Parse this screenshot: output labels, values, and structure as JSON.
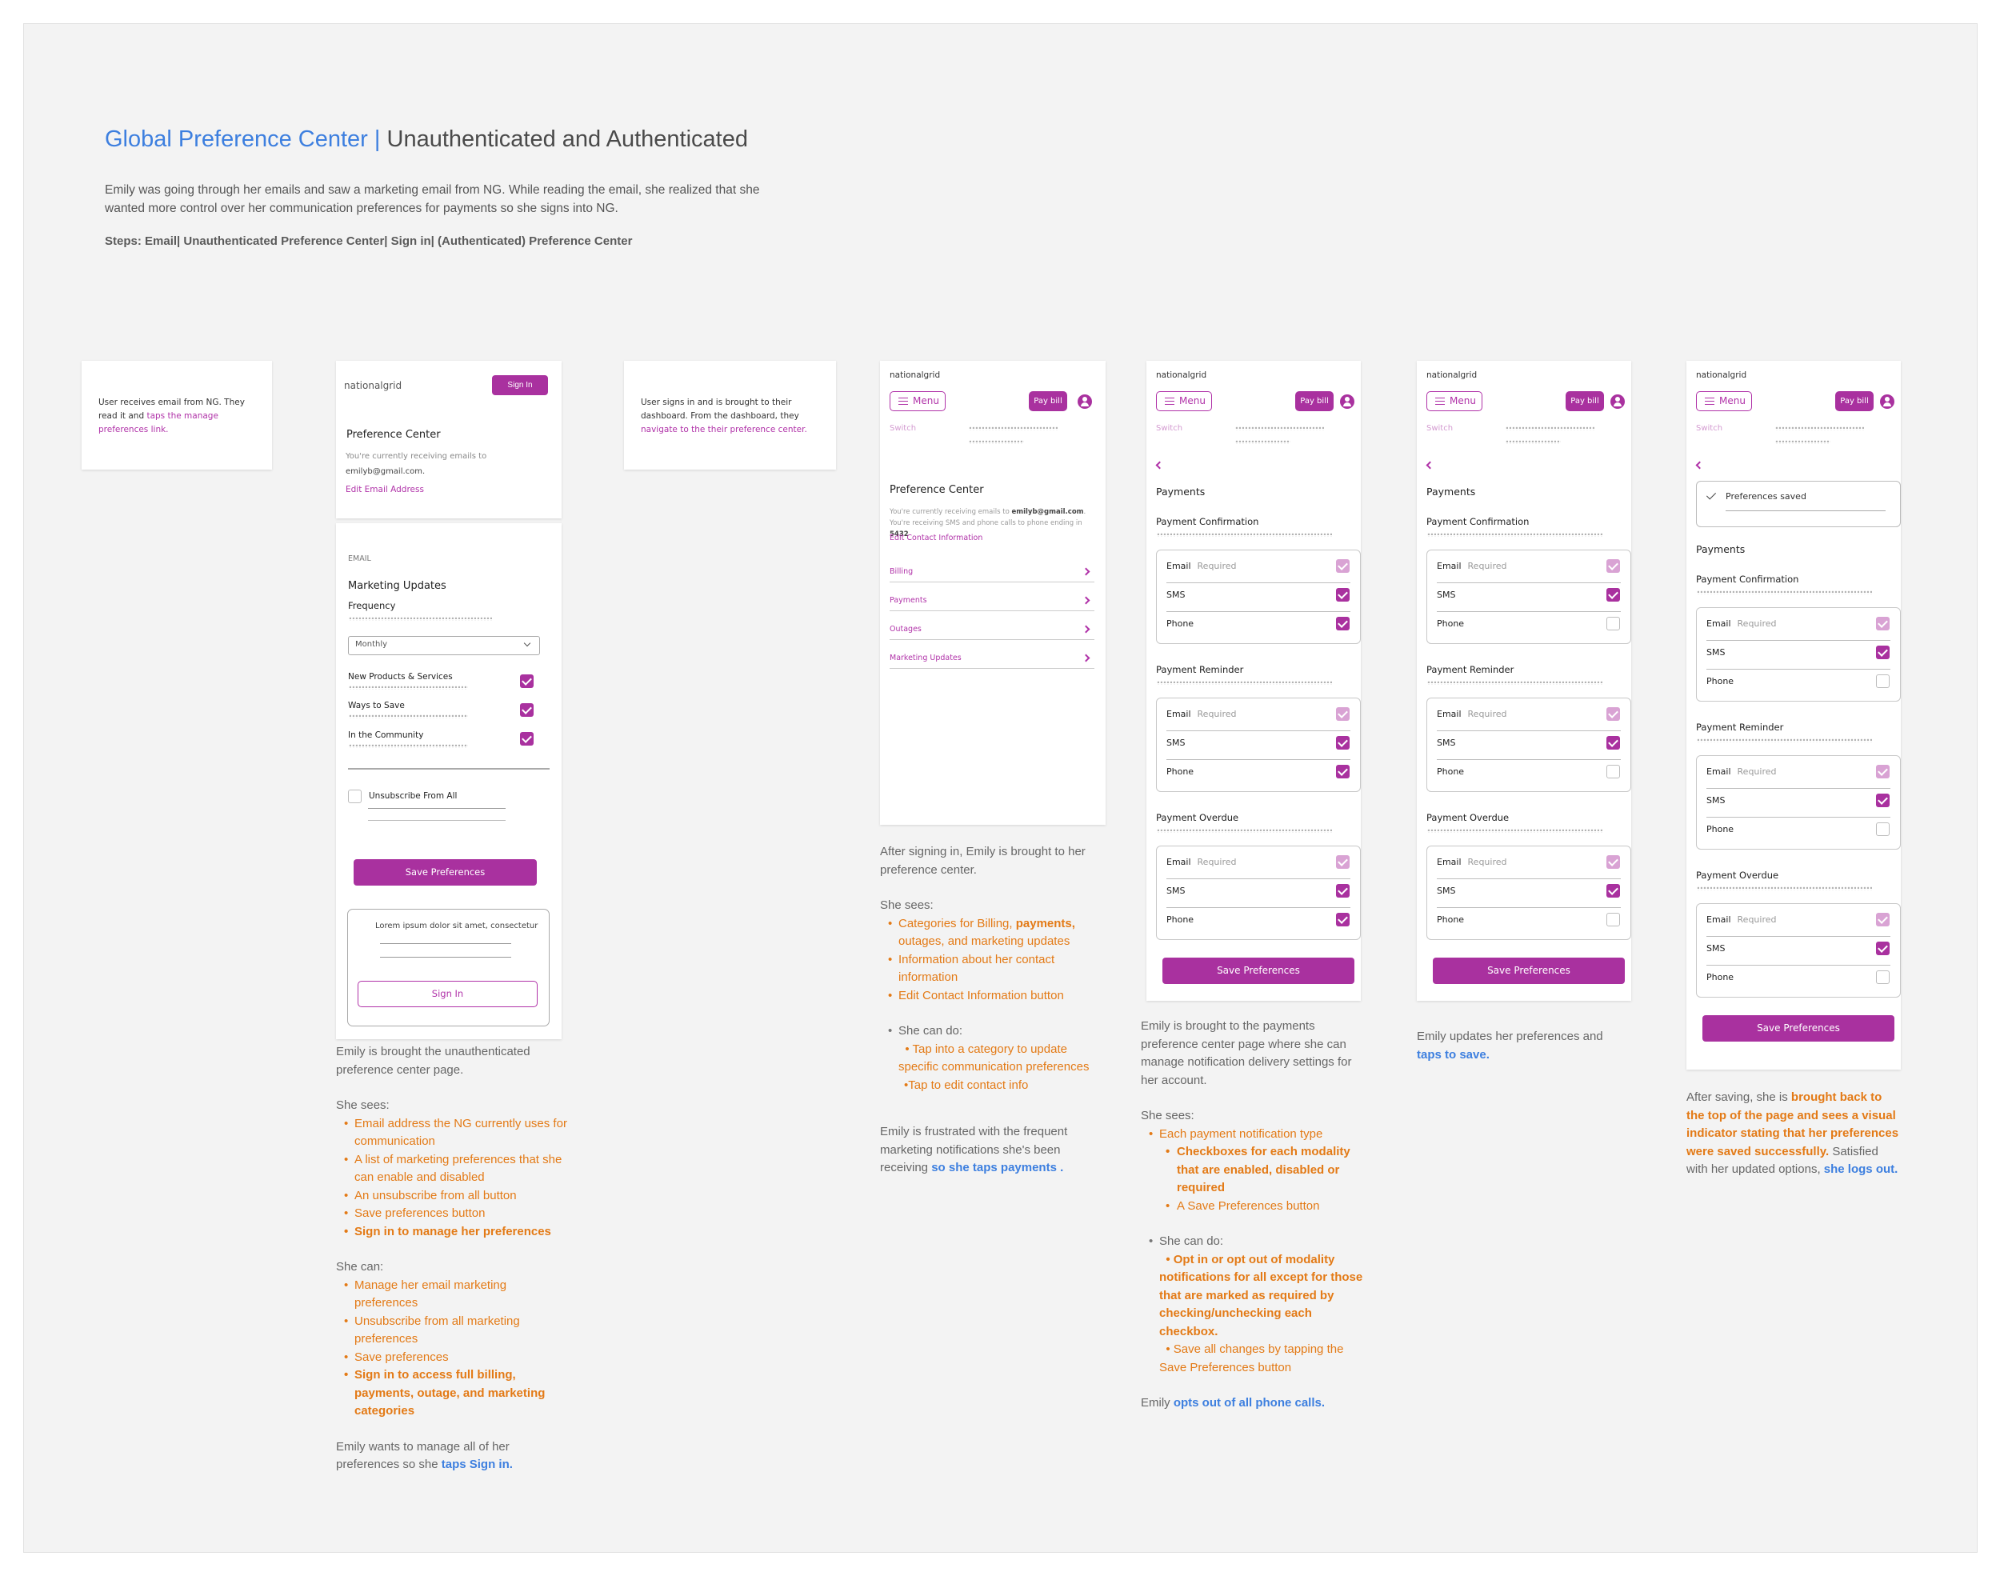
{
  "header": {
    "title_blue": "Global Preference Center |",
    "title_gray": " Unauthenticated and Authenticated",
    "intro": "Emily was going through her emails and saw a marketing email from NG. While reading the email, she realized that she wanted more control over her communication preferences for payments so she signs into NG.",
    "steps": "Steps: Email| Unauthenticated Preference Center| Sign in| (Authenticated) Preference Center"
  },
  "step1": {
    "text": "User receives email from NG. They read it and ",
    "link": "taps the manage preferences link."
  },
  "step3": {
    "text": "User signs in and is brought to their dashboard. From the dashboard, they ",
    "link": "navigate to the their preference center."
  },
  "unauth": {
    "logo": "nationalgrid",
    "sign_in_top": "Sign In",
    "title": "Preference Center",
    "receiving": "You're currently receiving emails to",
    "email": "emilyb@gmail.com.",
    "edit_email": "Edit Email Address",
    "section_label": "EMAIL",
    "marketing": "Marketing Updates",
    "frequency": "Frequency",
    "dropdown": "Monthly",
    "items": [
      "New Products & Services",
      "Ways to Save",
      "In the Community"
    ],
    "unsubscribe": "Unsubscribe From All",
    "save": "Save Preferences",
    "lorem": "Lorem ipsum dolor sit amet, consectetur",
    "sign_in_bottom": "Sign In"
  },
  "dashboard": {
    "logo": "nationalgrid",
    "menu": "Menu",
    "paybill": "Pay bill",
    "switch": "Switch",
    "title": "Preference Center",
    "info_1": "You're currently receiving emails to ",
    "info_email": "emilyb@gmail.com",
    "info_2": ". You're receiving SMS and phone calls to phone ending in ",
    "info_phone": "5432",
    "edit_contact": "Edit Contact Information",
    "categories": [
      "Billing",
      "Payments",
      "Outages",
      "Marketing Updates"
    ]
  },
  "payments_common": {
    "logo": "nationalgrid",
    "menu": "Menu",
    "paybill": "Pay bill",
    "switch": "Switch",
    "title": "Payments",
    "sections": [
      "Payment Confirmation",
      "Payment Reminder",
      "Payment Overdue"
    ],
    "rows": [
      "Email",
      "SMS",
      "Phone"
    ],
    "required": "Required",
    "save": "Save Preferences",
    "saved": "Preferences saved"
  },
  "notes": {
    "n1": {
      "intro": "Emily is brought the unauthenticated preference center page.",
      "sees": "She sees:",
      "sees_items": [
        "Email address the NG currently uses for communication",
        "A list of marketing preferences that she can enable and disabled",
        "An unsubscribe from all button",
        "Save preferences button"
      ],
      "sees_bold": "Sign in to manage her preferences",
      "can": "She can:",
      "can_items": [
        "Manage her email marketing preferences",
        "Unsubscribe from all marketing preferences",
        "Save preferences"
      ],
      "can_bold": "Sign in to access full billing, payments, outage, and marketing categories",
      "end": "Emily wants to manage all of her preferences so she ",
      "end_link": "taps Sign in."
    },
    "n2": {
      "intro": "After signing in, Emily is brought to her preference center.",
      "sees": "She sees:",
      "item1a": "Categories for Billing, ",
      "item1b": "payments,",
      "item1c": " outages, and marketing updates",
      "item2": "Information about her contact information",
      "item3": "Edit Contact Information button",
      "can": "She can do:",
      "can1": "Tap into a category to update specific communication preferences",
      "can2": "•Tap to edit contact info",
      "end": "Emily is frustrated with the frequent marketing notifications she's been receiving ",
      "end_link": "so she taps payments ."
    },
    "n3": {
      "intro": "Emily is brought to the payments preference center page where she can manage notification delivery settings for her account.",
      "sees": "She sees:",
      "item1": "Each payment notification type",
      "item2": "Checkboxes for each modality that are enabled, disabled or required",
      "item3": "A Save Preferences button",
      "can": "She can do:",
      "can1": "Opt in or opt out of modality notifications for all except for those that are marked as required by checking/unchecking each checkbox.",
      "can2": "Save all changes by tapping the Save Preferences button",
      "end": "Emily ",
      "end_link": "opts out of all phone calls."
    },
    "n4": {
      "text": "Emily updates her preferences and ",
      "link": "taps to save."
    },
    "n5": {
      "text1": "After saving, she is ",
      "bold": "brought back to the top of the page and sees a visual indicator stating that her preferences were saved successfully.",
      "text2": " Satisfied with her updated options, ",
      "link": "she logs out."
    }
  }
}
